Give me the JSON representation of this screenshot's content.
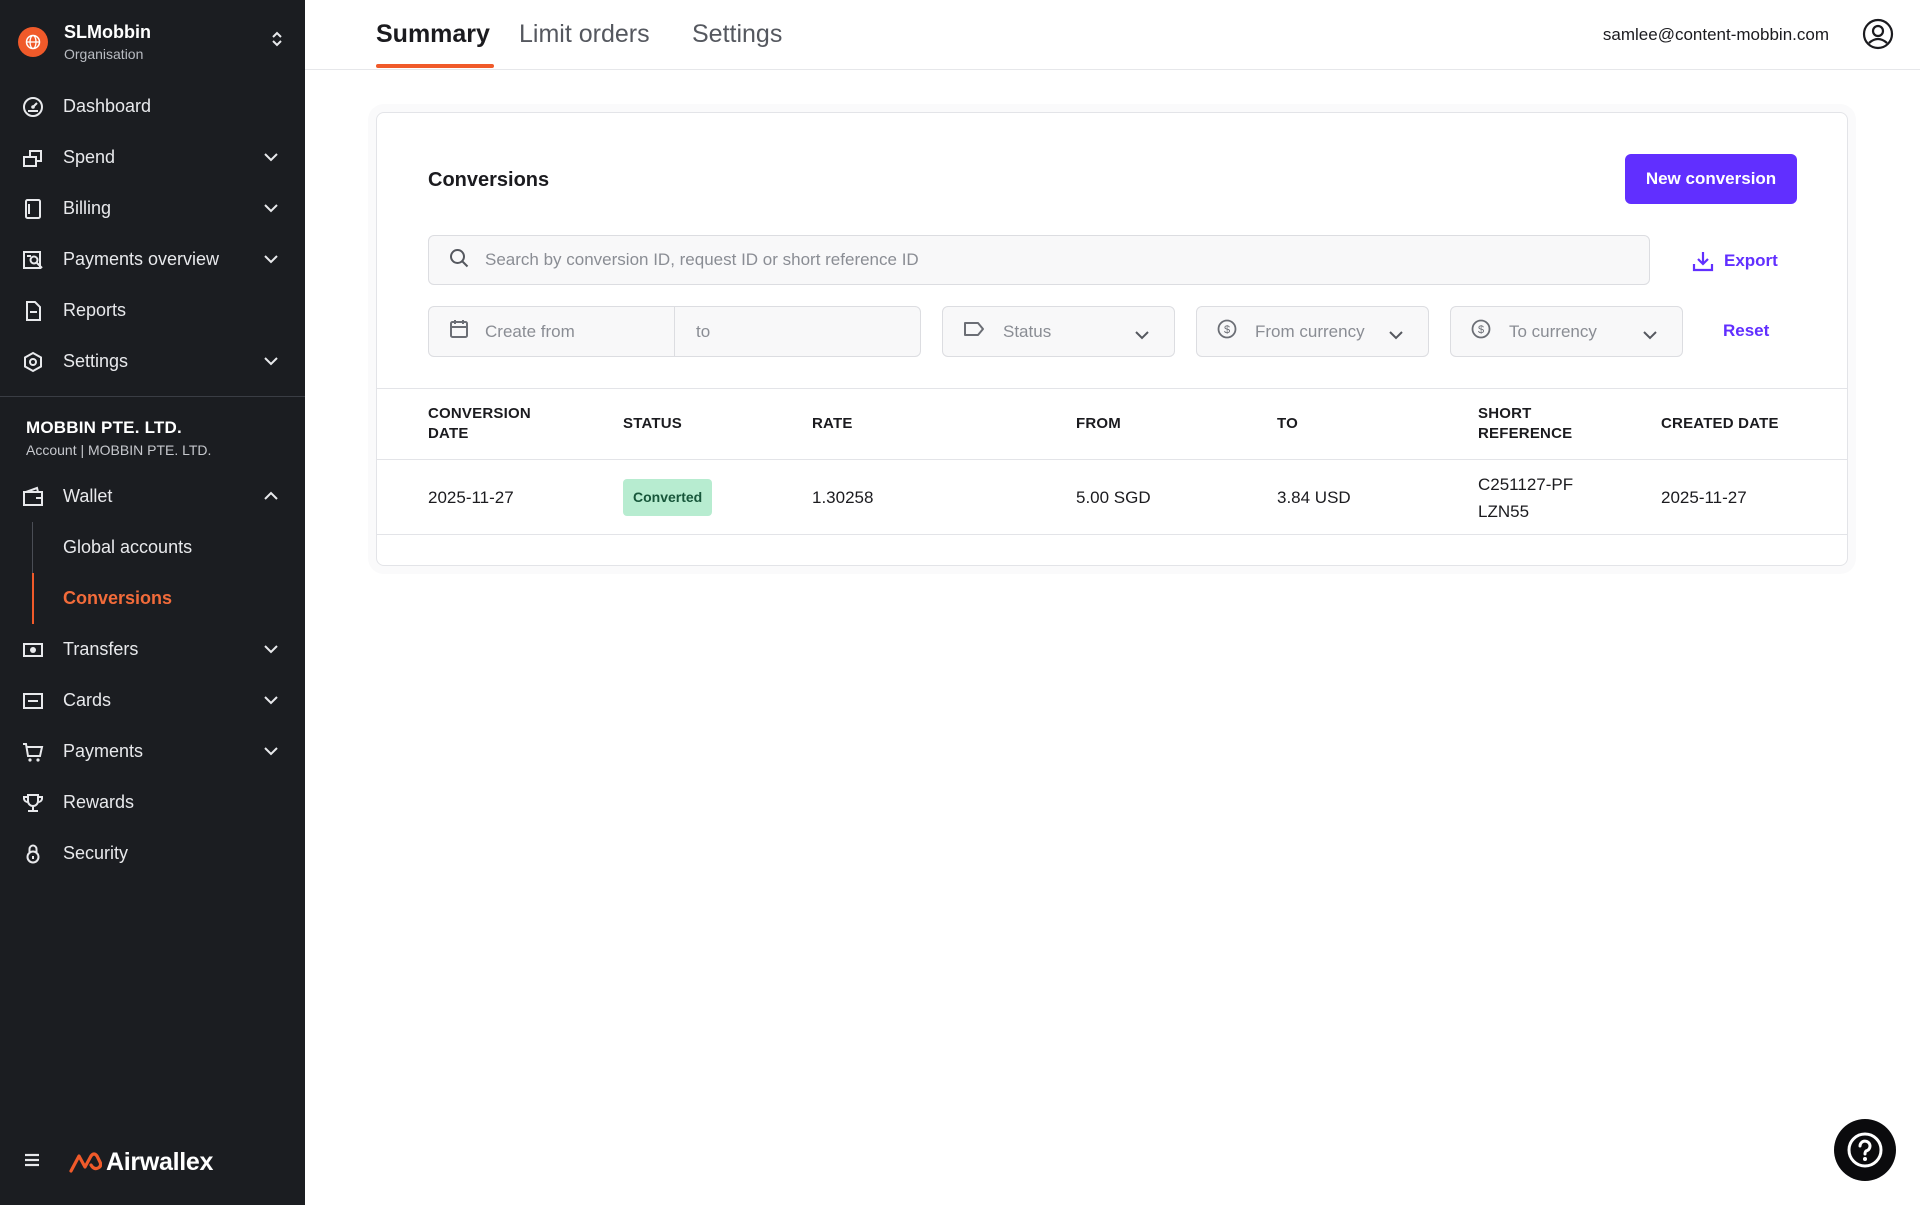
{
  "org": {
    "name": "SLMobbin",
    "subtitle": "Organisation"
  },
  "nav_main": [
    {
      "label": "Dashboard",
      "icon": "dashboard-icon"
    },
    {
      "label": "Spend",
      "icon": "spend-icon"
    },
    {
      "label": "Billing",
      "icon": "billing-icon"
    },
    {
      "label": "Payments overview",
      "icon": "payments-overview-icon"
    },
    {
      "label": "Reports",
      "icon": "reports-icon"
    },
    {
      "label": "Settings",
      "icon": "settings-icon"
    }
  ],
  "account": {
    "name": "MOBBIN PTE. LTD.",
    "subtitle": "Account | MOBBIN PTE. LTD."
  },
  "wallet": {
    "label": "Wallet",
    "items": [
      {
        "label": "Global accounts"
      },
      {
        "label": "Conversions"
      }
    ]
  },
  "nav_account": [
    {
      "label": "Transfers",
      "icon": "transfers-icon"
    },
    {
      "label": "Cards",
      "icon": "cards-icon"
    },
    {
      "label": "Payments",
      "icon": "cart-icon"
    },
    {
      "label": "Rewards",
      "icon": "trophy-icon"
    },
    {
      "label": "Security",
      "icon": "lock-icon"
    }
  ],
  "brand": {
    "name": "Airwallex",
    "accent": "#f05a2a"
  },
  "tabs": [
    {
      "label": "Summary"
    },
    {
      "label": "Limit orders"
    },
    {
      "label": "Settings"
    }
  ],
  "user": {
    "email": "samlee@content-mobbin.com"
  },
  "conversions": {
    "title": "Conversions",
    "new_button": "New conversion",
    "search_placeholder": "Search by conversion ID, request ID or short reference ID",
    "export_label": "Export",
    "filters": {
      "create_from": "Create from",
      "to": "to",
      "status": "Status",
      "from_currency": "From currency",
      "to_currency": "To currency",
      "reset": "Reset"
    },
    "columns": [
      "CONVERSION DATE",
      "STATUS",
      "RATE",
      "FROM",
      "TO",
      "SHORT REFERENCE",
      "CREATED DATE"
    ],
    "rows": [
      {
        "conversion_date": "2025-11-27",
        "status": "Converted",
        "rate": "1.30258",
        "from": "5.00 SGD",
        "to": "3.84 USD",
        "short_reference": "C251127-PFLZN55",
        "created_date": "2025-11-27"
      }
    ]
  },
  "colors": {
    "sidebar_bg": "#1b1d21",
    "primary": "#612fff",
    "accent": "#f05a2a",
    "badge_bg": "#b7ecd0"
  }
}
